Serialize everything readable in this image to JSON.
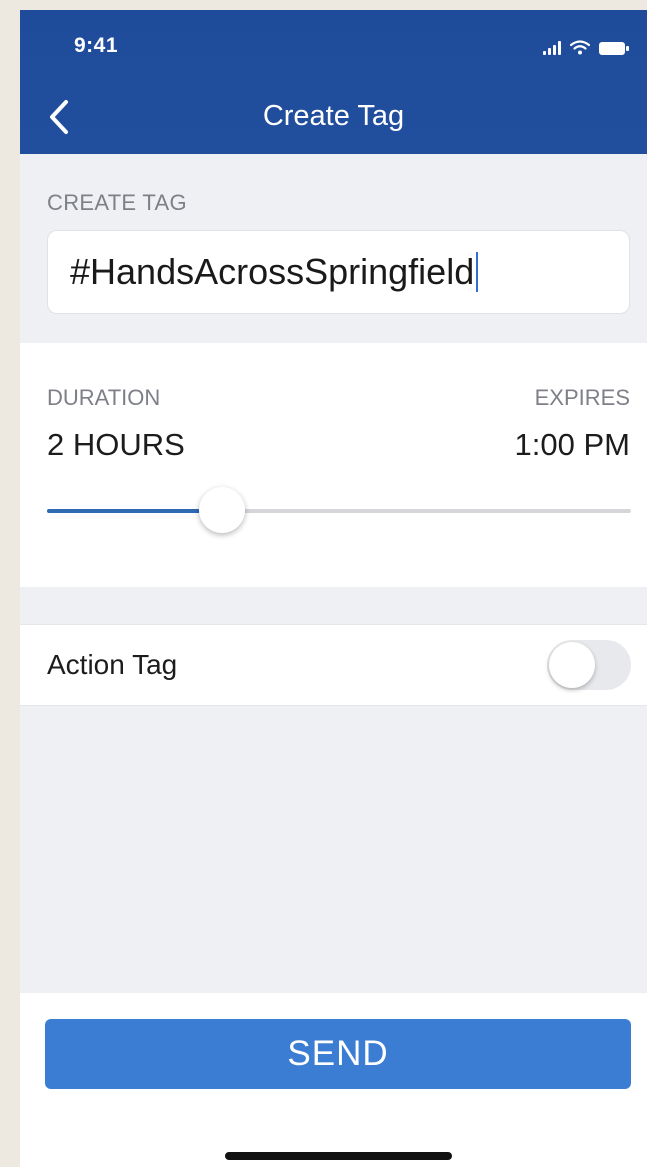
{
  "status_bar": {
    "time": "9:41"
  },
  "nav": {
    "title": "Create Tag",
    "back_icon": "chevron-left-icon"
  },
  "create_tag": {
    "section_label": "CREATE TAG",
    "value": "#HandsAcrossSpringfield"
  },
  "duration": {
    "label": "DURATION",
    "value": "2 HOURS",
    "expires_label": "EXPIRES",
    "expires_value": "1:00 PM",
    "slider_fraction": 0.3
  },
  "action_tag": {
    "label": "Action Tag",
    "enabled": false
  },
  "send_button": {
    "label": "SEND"
  },
  "colors": {
    "header": "#214f9e",
    "accent": "#3a7dd3",
    "slider_fill": "#2f6ab5"
  }
}
